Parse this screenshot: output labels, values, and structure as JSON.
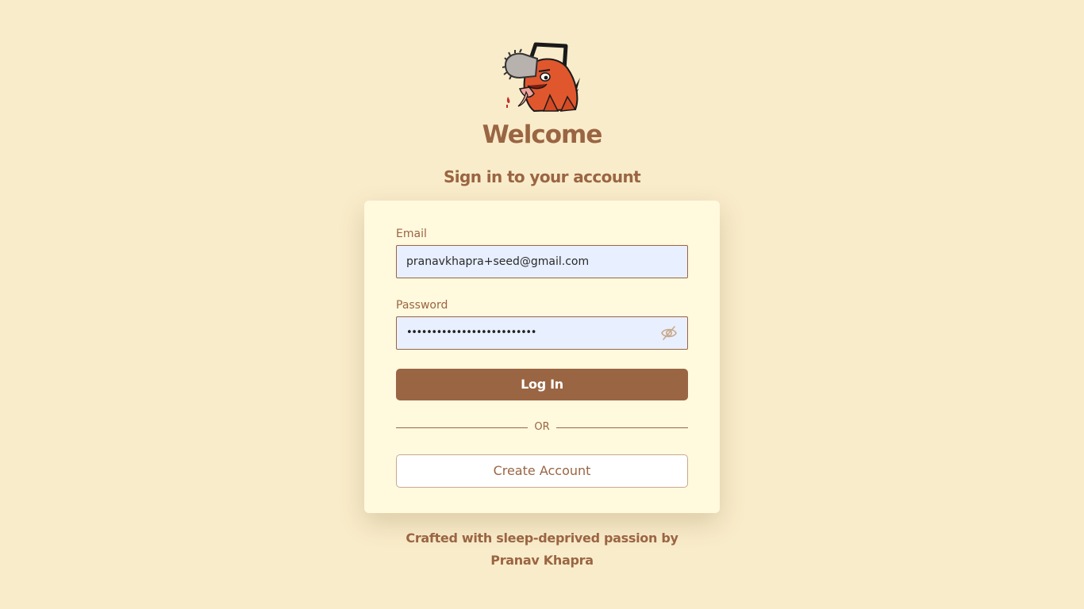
{
  "header": {
    "logo_icon": "chainsaw-devil-mascot-icon",
    "title": "Welcome",
    "subtitle": "Sign in to your account"
  },
  "form": {
    "email_label": "Email",
    "email_value": "pranavkhapra+seed@gmail.com",
    "password_label": "Password",
    "password_masked": "••••••••••••••••••••••••••",
    "password_toggle_icon": "eye-off-icon",
    "login_label": "Log In",
    "divider_label": "OR",
    "create_label": "Create Account"
  },
  "footer": {
    "line1": "Crafted with sleep-deprived passion by",
    "line2": "Pranav Khapra"
  },
  "colors": {
    "background": "#f9ecca",
    "card": "#fff9de",
    "accent": "#9a6543",
    "input_fill": "#e8effe"
  }
}
